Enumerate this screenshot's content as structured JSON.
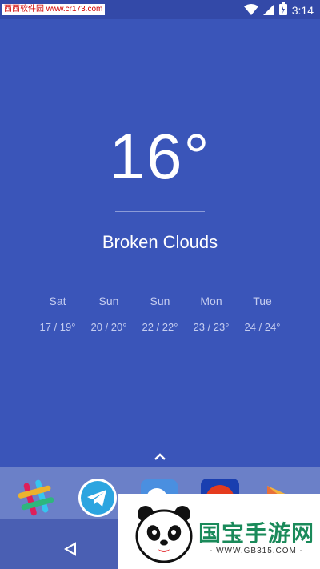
{
  "status_bar": {
    "time": "3:14",
    "watermark": "西西软件园 www.cr173.com"
  },
  "weather": {
    "temperature": "16°",
    "condition": "Broken Clouds",
    "forecast": [
      {
        "day": "Sat",
        "range": "17 / 19°"
      },
      {
        "day": "Sun",
        "range": "20 / 20°"
      },
      {
        "day": "Sun",
        "range": "22 / 22°"
      },
      {
        "day": "Mon",
        "range": "23 / 23°"
      },
      {
        "day": "Tue",
        "range": "24 / 24°"
      }
    ]
  },
  "dock": {
    "apps": [
      "slack-icon",
      "telegram-icon",
      "chat-app-icon",
      "red-ball-app-icon",
      "play-app-icon"
    ]
  },
  "watermark_overlay": {
    "brand": "国宝手游网",
    "url": "- WWW.GB315.COM -"
  },
  "colors": {
    "background": "#3a55b9",
    "status_bar": "#3349a8",
    "dock": "#6b80c8",
    "nav_bar": "#4a5fb3"
  }
}
